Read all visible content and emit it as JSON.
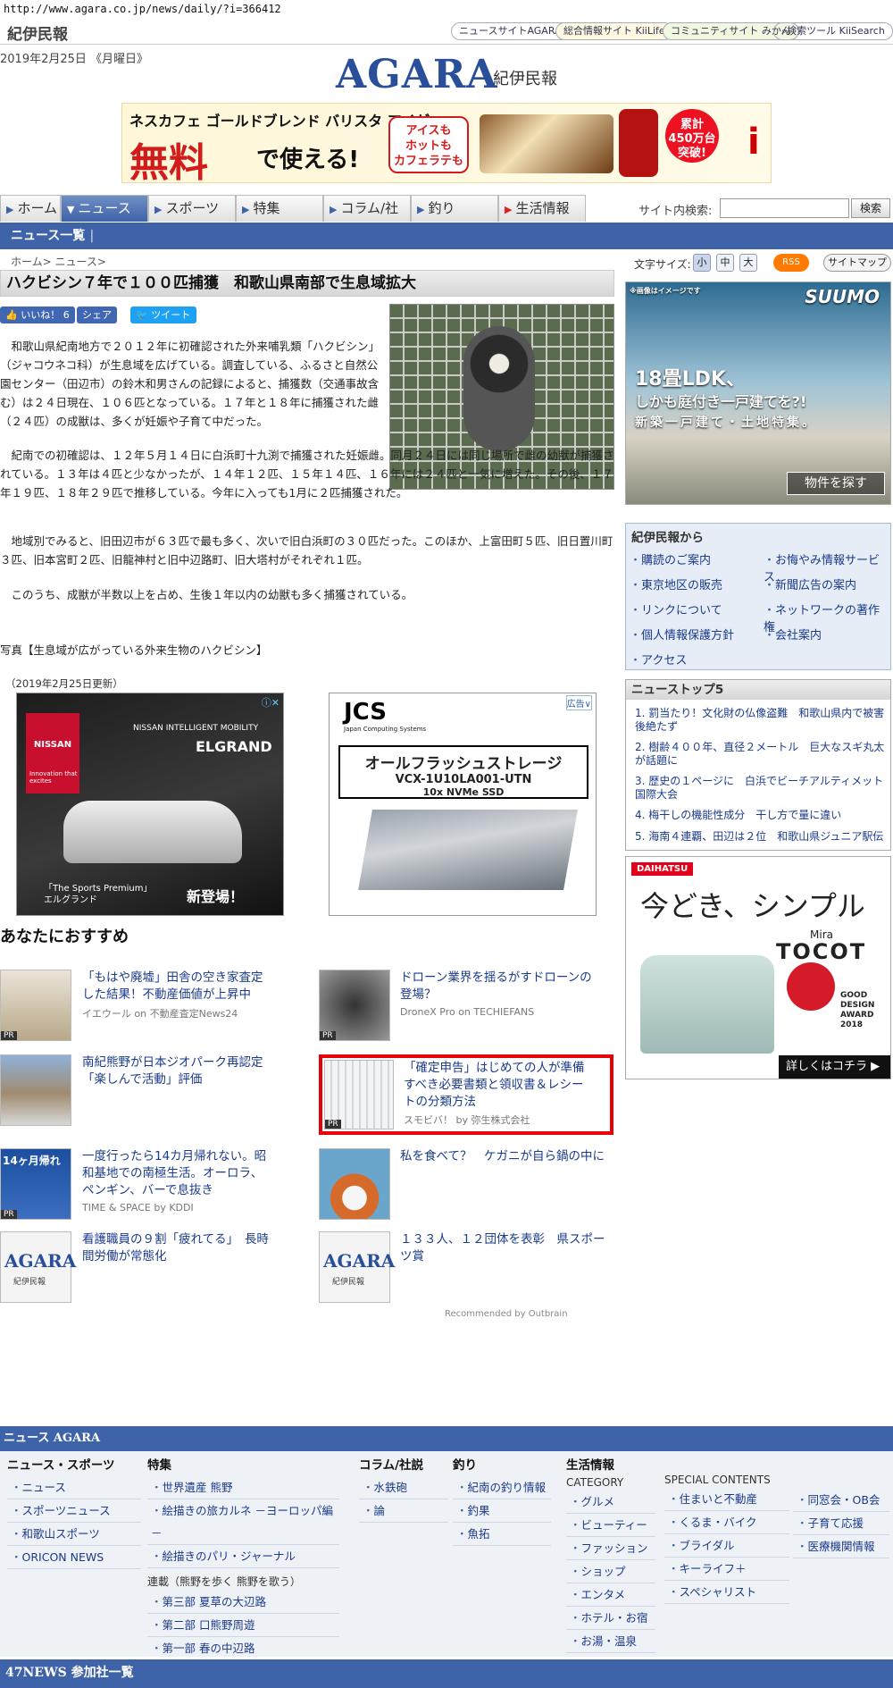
{
  "url": "http://www.agara.co.jp/news/daily/?i=366412",
  "header": {
    "logo": "紀伊民報",
    "sites": [
      "ニュースサイトAGARA",
      "総合情報サイト KiiLife",
      "コミュニティサイト みかん",
      "検索ツール KiiSearch"
    ],
    "date": "2019年2月25日 《月曜日》",
    "brand": "AGARA",
    "brand_sub": "紀伊民報"
  },
  "banner": {
    "line1": "ネスカフェ ゴールドブレンド バリスタ アイが",
    "line2": "無料",
    "line3": "で使える!",
    "pill": "アイスも\nホットも\nカフェラテも",
    "star": "累計\n450万台\n突破!",
    "i": "i"
  },
  "nav": {
    "tabs": [
      "ホーム",
      "ニュース",
      "スポーツ",
      "特集",
      "コラム/社説",
      "釣り",
      "生活情報"
    ],
    "search_label": "サイト内検索:",
    "search_button": "検索",
    "sub": "ニュース一覧"
  },
  "article": {
    "breadcrumb": "ホーム> ニュース>",
    "title": "ハクビシン７年で１００匹捕獲　和歌山県南部で生息域拡大",
    "like": "いいね！ 6",
    "share": "シェア",
    "tweet": "ツイート",
    "p1": "　和歌山県紀南地方で２０１２年に初確認された外来哺乳類「ハクビシン」（ジャコウネコ科）が生息域を広げている。調査している、ふるさと自然公園センター（田辺市）の鈴木和男さんの記録によると、捕獲数（交通事故含む）は２４日現在、１０６匹となっている。１７年と１８年に捕獲された雌（２４匹）の成獣は、多くが妊娠や子育て中だった。",
    "p2": "　紀南での初確認は、１２年５月１４日に白浜町十九渕で捕獲された妊娠雌。同月２４日には同じ場所で雌の幼獣が捕獲されている。１３年は４匹と少なかったが、１４年１２匹、１５年１４匹、１６年には２４匹と一気に増えた。その後、１７年１９匹、１８年２９匹で推移している。今年に入っても1月に２匹捕獲された。",
    "p3": "　地域別でみると、旧田辺市が６３匹で最も多く、次いで旧白浜町の３０匹だった。このほか、上富田町５匹、旧日置川町３匹、旧本宮町２匹、旧龍神村と旧中辺路町、旧大塔村がそれぞれ１匹。",
    "p4": "　このうち、成獣が半数以上を占め、生後１年以内の幼獣も多く捕獲されている。",
    "caption": "写真【生息域が広がっている外来生物のハクビシン】",
    "updated": "（2019年2月25日更新）"
  },
  "ads": {
    "nissan": {
      "brand": "NISSAN",
      "tag": "Innovation that excites",
      "slogan": "NISSAN INTELLIGENT MOBILITY",
      "model": "ELGRAND",
      "sp": "「The Sports Premium」\nエルグランド",
      "new": "新登場！"
    },
    "jcs": {
      "logo": "JCS",
      "sub": "Japan Computing Systems",
      "label": "広告",
      "l1": "オールフラッシュストレージ",
      "l2": "VCX-1U10LA001-UTN",
      "l3": "10x NVMe SSD"
    }
  },
  "reco": {
    "title": "あなたにおすすめ",
    "items": [
      {
        "t": "「もはや廃墟」田舎の空き家査定した結果！不動産価値が上昇中",
        "s": "イエウール on 不動産査定News24",
        "pr": "PR"
      },
      {
        "t": "ドローン業界を揺るがすドローンの登場？",
        "s": "DroneX Pro on TECHIEFANS",
        "pr": "PR"
      },
      {
        "t": "南紀熊野が日本ジオパーク再認定　「楽しんで活動」評価",
        "s": "",
        "pr": ""
      },
      {
        "t": "「確定申告」はじめての人が準備すべき必要書類と領収書＆レシートの分類方法",
        "s": "スモビバ！ by 弥生株式会社",
        "pr": "PR"
      },
      {
        "t": "一度行ったら14カ月帰れない。昭和基地での南極生活。オーロラ、ペンギン、バーで息抜き",
        "s": "TIME & SPACE by KDDI",
        "pr": "PR"
      },
      {
        "t": "私を食べて？　ケガニが自ら鍋の中に",
        "s": "",
        "pr": ""
      },
      {
        "t": "看護職員の９割「疲れてる」　長時間労働が常態化",
        "s": "",
        "pr": ""
      },
      {
        "t": "１３３人、１２団体を表彰　県スポーツ賞",
        "s": "",
        "pr": ""
      }
    ],
    "thumb_logo": "AGARA",
    "thumb_logo2": "紀伊民報",
    "antarctic": "14ヶ月帰れ",
    "outbrain": "Recommended by Outbrain"
  },
  "side": {
    "font_label": "文字サイズ:",
    "font_btns": [
      "小",
      "中",
      "大"
    ],
    "rss": "RSS",
    "sitemap": "サイトマップ",
    "suumo": {
      "note": "※画像はイメージです",
      "logo": "SUUMO",
      "l1": "18畳LDK、",
      "l2": "しかも庭付き一戸建てを?!",
      "l3": "新築一戸建て・土地特集。",
      "btn": "物件を探す"
    },
    "kii": {
      "title": "紀伊民報から",
      "items": [
        "購読のご案内",
        "お悔やみ情報サービス",
        "東京地区の販売",
        "新聞広告の案内",
        "リンクについて",
        "ネットワークの著作権",
        "個人情報保護方針",
        "会社案内",
        "アクセス"
      ]
    },
    "top5": {
      "title": "ニューストップ5",
      "items": [
        "罰当たり！文化財の仏像盗難　和歌山県内で被害後絶たず",
        "樹齢４００年、直径２メートル　巨大なスギ丸太が話題に",
        "歴史の１ページに　白浜でビーチアルティメット国際大会",
        "梅干しの機能性成分　干し方で量に違い",
        "海南４連覇、田辺は２位　和歌山県ジュニア駅伝"
      ]
    },
    "daihatsu": {
      "logo": "DAIHATSU",
      "big": "今どき、シンプル",
      "mira": "Mira",
      "tocot": "TOCOT",
      "award": "GOOD DESIGN AWARD 2018",
      "more": "詳しくはコチラ ▶"
    }
  },
  "footer": {
    "bar": "ニュース AGARA",
    "cols": [
      {
        "h": "ニュース・スポーツ",
        "items": [
          "ニュース",
          "スポーツニュース",
          "和歌山スポーツ",
          "ORICON NEWS"
        ]
      },
      {
        "h": "特集",
        "items": [
          "世界遺産 熊野",
          "絵描きの旅カルネ －ヨーロッパ編－",
          "絵描きのパリ・ジャーナル"
        ],
        "sub": "連載（熊野を歩く 熊野を歌う）",
        "items2": [
          "第三部 夏草の大辺路",
          "第二部 口熊野周遊",
          "第一部 春の中辺路"
        ]
      },
      {
        "h": "コラム/社説",
        "items": [
          "水鉄砲",
          "論"
        ]
      },
      {
        "h": "釣り",
        "items": [
          "紀南の釣り情報",
          "釣果",
          "魚拓"
        ]
      },
      {
        "h": "生活情報",
        "sub": "CATEGORY",
        "items": [
          "グルメ",
          "ビューティー",
          "ファッション",
          "ショップ",
          "エンタメ",
          "ホテル・お宿",
          "お湯・温泉"
        ]
      },
      {
        "h": "",
        "sub": "SPECIAL CONTENTS",
        "items": [
          "住まいと不動産",
          "くるま・バイク",
          "ブライダル",
          "キーライフ＋",
          "スペシャリスト"
        ]
      },
      {
        "h": "",
        "items": [
          "同窓会・OB会",
          "子育て応援",
          "医療機関情報"
        ]
      }
    ],
    "bar2": "47NEWS 参加社一覧"
  }
}
